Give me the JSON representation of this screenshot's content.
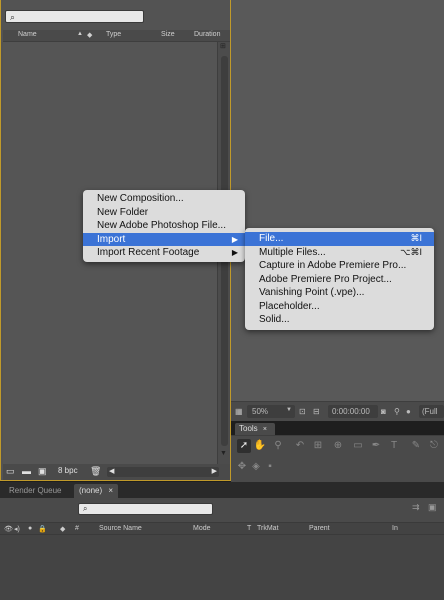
{
  "project_panel": {
    "columns": [
      "Name",
      "Type",
      "Size",
      "Duration"
    ],
    "bpc_label": "8 bpc"
  },
  "context_menu": {
    "items": [
      {
        "label": "New Composition...",
        "highlighted": false,
        "submenu": false
      },
      {
        "label": "New Folder",
        "highlighted": false,
        "submenu": false
      },
      {
        "label": "New Adobe Photoshop File...",
        "highlighted": false,
        "submenu": false
      },
      {
        "label": "Import",
        "highlighted": true,
        "submenu": true
      },
      {
        "label": "Import Recent Footage",
        "highlighted": false,
        "submenu": true
      }
    ]
  },
  "import_submenu": {
    "items": [
      {
        "label": "File...",
        "shortcut": "⌘I",
        "highlighted": true
      },
      {
        "label": "Multiple Files...",
        "shortcut": "⌥⌘I",
        "highlighted": false
      },
      {
        "label": "Capture in Adobe Premiere Pro...",
        "shortcut": "",
        "highlighted": false
      },
      {
        "label": "Adobe Premiere Pro Project...",
        "shortcut": "",
        "highlighted": false
      },
      {
        "label": "Vanishing Point (.vpe)...",
        "shortcut": "",
        "highlighted": false
      },
      {
        "label": "Placeholder...",
        "shortcut": "",
        "highlighted": false
      },
      {
        "label": "Solid...",
        "shortcut": "",
        "highlighted": false
      }
    ]
  },
  "composition_bar": {
    "zoom": "50%",
    "timecode": "0:00:00:00",
    "resolution": "(Full"
  },
  "tools_panel": {
    "title": "Tools"
  },
  "bottom_tabs": {
    "render_queue": "Render Queue",
    "comp_tab": "(none)"
  },
  "timeline": {
    "columns": [
      "#",
      "Source Name",
      "Mode",
      "T",
      "TrkMat",
      "Parent",
      "In"
    ]
  },
  "colors": {
    "highlight": "#3b73d6",
    "panel_border_active": "#c09a2a",
    "menu_bg": "#dcdcdc"
  }
}
